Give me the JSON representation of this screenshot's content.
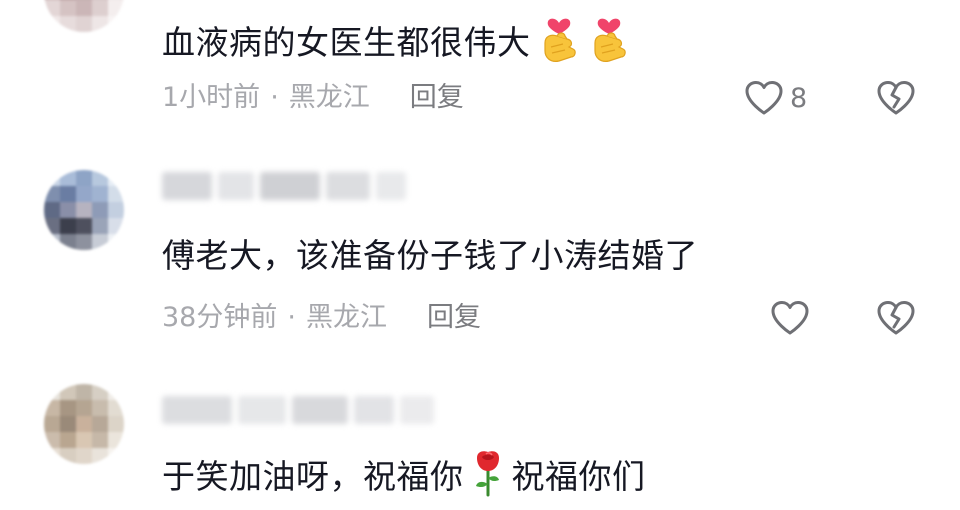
{
  "comments": [
    {
      "text": "血液病的女医生都很伟大",
      "emoji": "finger-heart-icon",
      "time": "1小时前",
      "location": "黑龙江",
      "reply_label": "回复",
      "like_count": "8"
    },
    {
      "text": "傅老大，该准备份子钱了小涛结婚了",
      "time": "38分钟前",
      "location": "黑龙江",
      "reply_label": "回复",
      "like_count": ""
    },
    {
      "text_before": "于笑加油呀，祝福你",
      "emoji": "rose-icon",
      "text_after": "祝福你们"
    }
  ],
  "meta_separator": "·",
  "colors": {
    "text": "#161823",
    "meta": "#a7a8ad",
    "reply": "#7b7c80",
    "icon": "#6f7075"
  }
}
